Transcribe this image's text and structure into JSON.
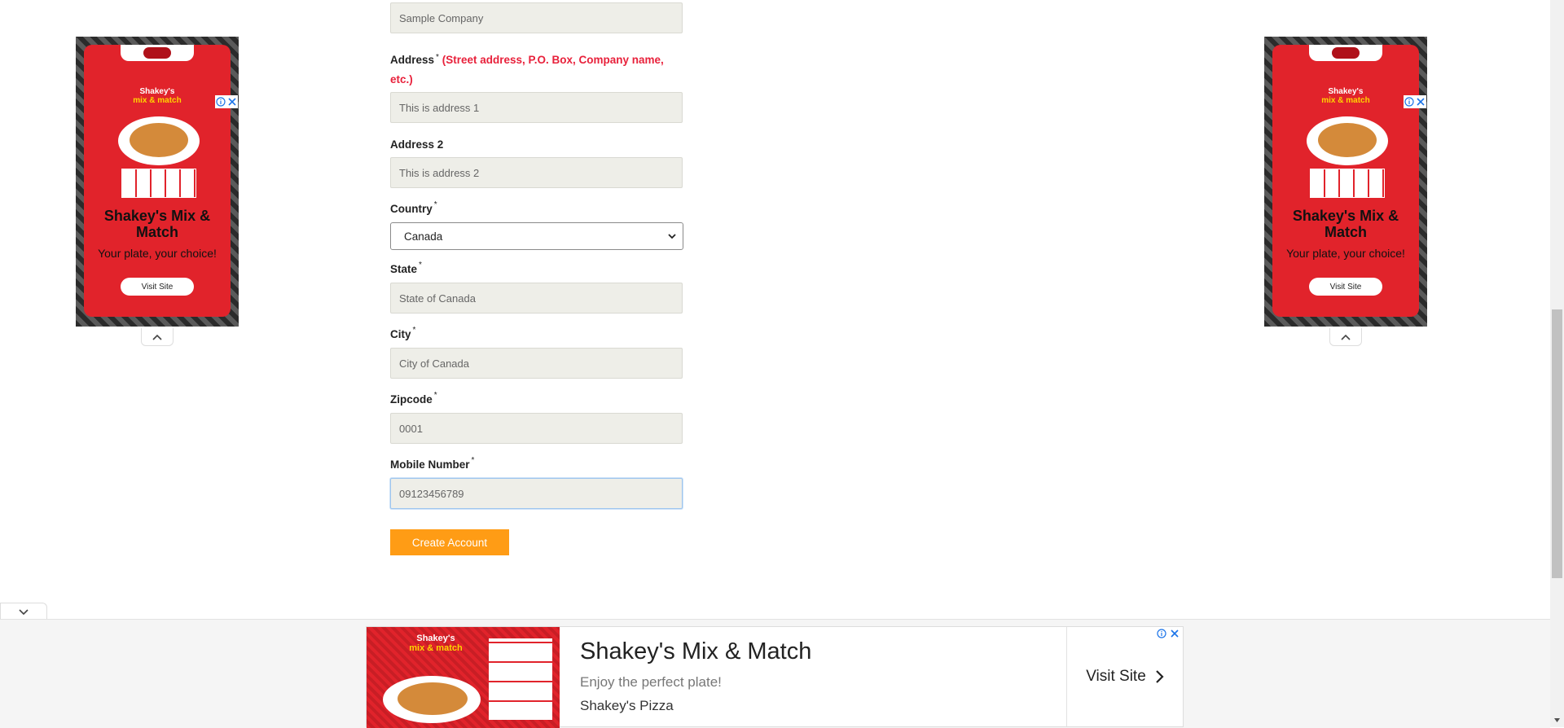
{
  "form": {
    "company": {
      "value": "Sample Company"
    },
    "address": {
      "label": "Address",
      "required_mark": "*",
      "hint": "(Street address, P.O. Box, Company name, etc.)",
      "value": "This is address 1"
    },
    "address2": {
      "label": "Address 2",
      "value": "This is address 2"
    },
    "country": {
      "label": "Country",
      "required_mark": "*",
      "selected": "Canada"
    },
    "state": {
      "label": "State",
      "required_mark": "*",
      "value": "State of Canada"
    },
    "city": {
      "label": "City",
      "required_mark": "*",
      "value": "City of Canada"
    },
    "zipcode": {
      "label": "Zipcode",
      "required_mark": "*",
      "value": "0001"
    },
    "mobile": {
      "label": "Mobile Number",
      "required_mark": "*",
      "value": "09123456789"
    },
    "submit_label": "Create Account"
  },
  "side_ad": {
    "promo_title_line1": "Shakey's",
    "promo_title_line2": "mix & match",
    "headline": "Shakey's Mix & Match",
    "tagline": "Your plate, your choice!",
    "cta": "Visit Site"
  },
  "banner_ad": {
    "title": "Shakey's Mix & Match",
    "description": "Enjoy the perfect plate!",
    "advertiser": "Shakey's Pizza",
    "cta": "Visit Site",
    "brand_line1": "Shakey's",
    "brand_line2": "mix & match"
  },
  "icons": {
    "adchoices": "info-icon",
    "close": "close-icon",
    "collapse": "chevron-up-icon",
    "expand": "chevron-down-icon",
    "cta_arrow": "chevron-right-icon"
  },
  "colors": {
    "accent_button": "#ff9c15",
    "required_hint": "#e8213b",
    "input_bg": "#eeeee8",
    "ad_red": "#e1232b"
  }
}
